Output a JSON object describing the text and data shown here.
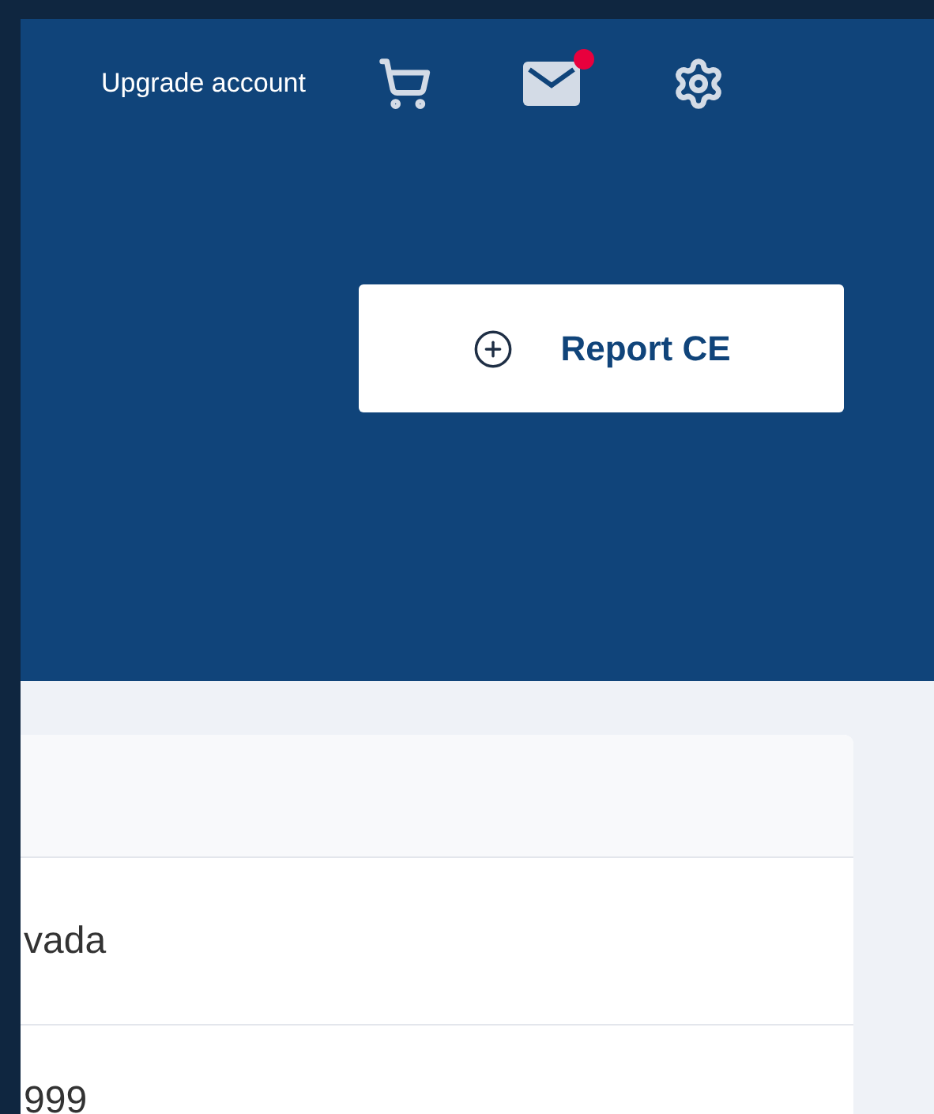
{
  "header": {
    "upgrade_link": "Upgrade account",
    "mail_unread": true
  },
  "report_button": {
    "label": "Report CE"
  },
  "table": {
    "rows": [
      {
        "cell": "vada"
      },
      {
        "cell": "999"
      }
    ]
  }
}
